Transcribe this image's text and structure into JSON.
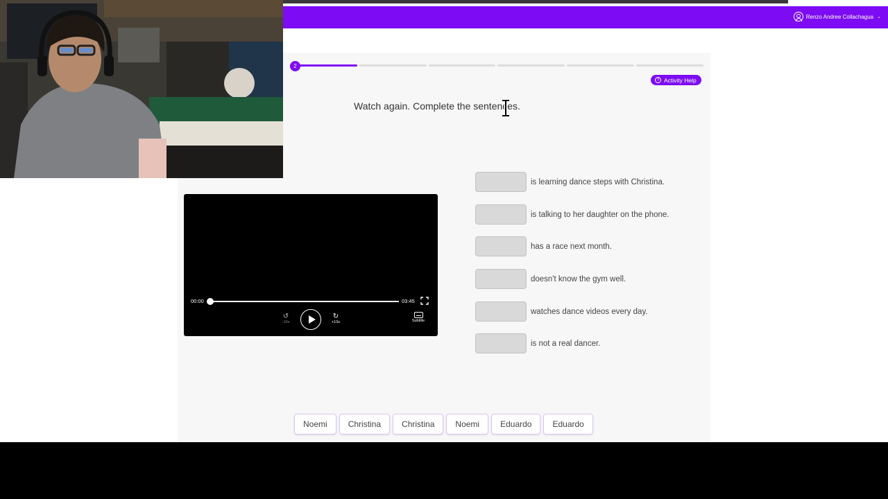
{
  "header": {
    "user_name": "Renzo Andree Collachagua",
    "brand_color": "#7d0cf4"
  },
  "activity": {
    "current_step": "2",
    "total_segments": 6,
    "completed_segments": 1,
    "help_label": "Activity Help",
    "instruction": "Watch again. Complete the sentences."
  },
  "video": {
    "current_time": "00:00",
    "duration": "03:45",
    "back_label": "-10s",
    "forward_label": "+10s",
    "subtitle_label": "Subtitle",
    "progress": 0
  },
  "sentences": [
    {
      "text": "is learning dance steps with Christina."
    },
    {
      "text": "is talking to her daughter on the phone."
    },
    {
      "text": "has a race next month."
    },
    {
      "text": "doesn't know the gym well."
    },
    {
      "text": "watches dance videos every day."
    },
    {
      "text": "is not a real dancer."
    }
  ],
  "word_bank": [
    "Noemi",
    "Christina",
    "Christina",
    "Noemi",
    "Eduardo",
    "Eduardo"
  ]
}
